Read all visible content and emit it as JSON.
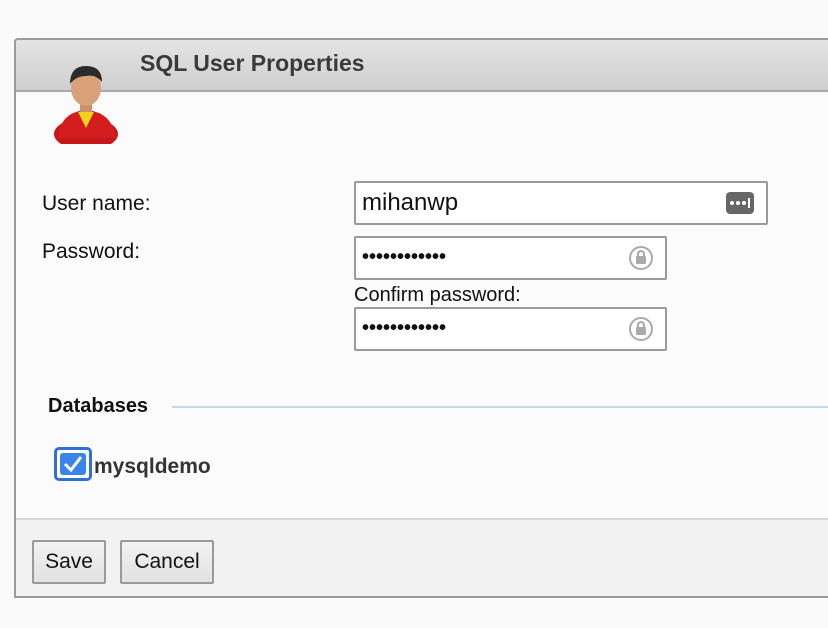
{
  "dialog": {
    "title": "SQL User Properties",
    "user_name_label": "User name:",
    "user_name_value": "mihanwp",
    "password_label": "Password:",
    "password_value": "••••••••••••",
    "confirm_password_label": "Confirm password:",
    "confirm_password_value": "••••••••••••"
  },
  "databases": {
    "title": "Databases",
    "items": [
      {
        "label": "mysqldemo",
        "checked": true
      }
    ]
  },
  "buttons": {
    "save": "Save",
    "cancel": "Cancel"
  },
  "icons": {
    "avatar": "user-avatar-icon",
    "password_manager": "password-manager-key-icon",
    "password_generate": "lock-refresh-icon"
  },
  "colors": {
    "checkbox_accent": "#3a83e8",
    "titlebar": "#d6d6d6"
  }
}
